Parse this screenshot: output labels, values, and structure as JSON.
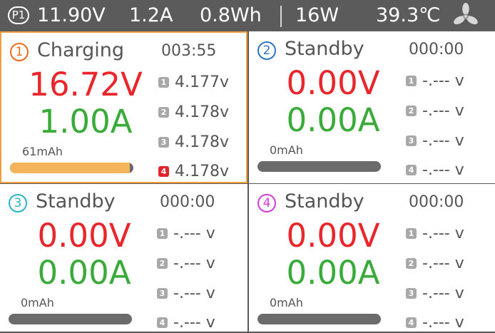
{
  "header": {
    "program": "P1",
    "voltage": "11.90V",
    "current": "1.2A",
    "energy": "0.8Wh",
    "power": "16W",
    "temperature": "39.3℃",
    "fan_icon": "fan-icon"
  },
  "colors": {
    "voltage": "#e8262b",
    "current": "#3aab3a",
    "active_border": "#f0a040",
    "progress_fill": "#f4b45a"
  },
  "channels": [
    {
      "number": "1",
      "accent": "#f06a1c",
      "active": true,
      "status": "Charging",
      "timer": "003:55",
      "voltage": "16.72V",
      "current": "1.00A",
      "capacity": "61mAh",
      "progress": 0.97,
      "cells": [
        {
          "index": "1",
          "value": "4.177v"
        },
        {
          "index": "2",
          "value": "4.178v"
        },
        {
          "index": "3",
          "value": "4.178v"
        },
        {
          "index": "4",
          "value": "4.178v",
          "highlight": true
        }
      ]
    },
    {
      "number": "2",
      "accent": "#2f74c8",
      "active": false,
      "status": "Standby",
      "timer": "000:00",
      "voltage": "0.00V",
      "current": "0.00A",
      "capacity": "0mAh",
      "progress": 0,
      "cells": [
        {
          "index": "1",
          "value": "-.--- v"
        },
        {
          "index": "2",
          "value": "-.--- v"
        },
        {
          "index": "3",
          "value": "-.--- v"
        },
        {
          "index": "4",
          "value": "-.--- v"
        }
      ]
    },
    {
      "number": "3",
      "accent": "#29b5c5",
      "active": false,
      "status": "Standby",
      "timer": "000:00",
      "voltage": "0.00V",
      "current": "0.00A",
      "capacity": "0mAh",
      "progress": 0,
      "cells": [
        {
          "index": "1",
          "value": "-.--- v"
        },
        {
          "index": "2",
          "value": "-.--- v"
        },
        {
          "index": "3",
          "value": "-.--- v"
        },
        {
          "index": "4",
          "value": "-.--- v"
        }
      ]
    },
    {
      "number": "4",
      "accent": "#d43cd8",
      "active": false,
      "status": "Standby",
      "timer": "000:00",
      "voltage": "0.00V",
      "current": "0.00A",
      "capacity": "0mAh",
      "progress": 0,
      "cells": [
        {
          "index": "1",
          "value": "-.--- v"
        },
        {
          "index": "2",
          "value": "-.--- v"
        },
        {
          "index": "3",
          "value": "-.--- v"
        },
        {
          "index": "4",
          "value": "-.--- v"
        }
      ]
    }
  ]
}
